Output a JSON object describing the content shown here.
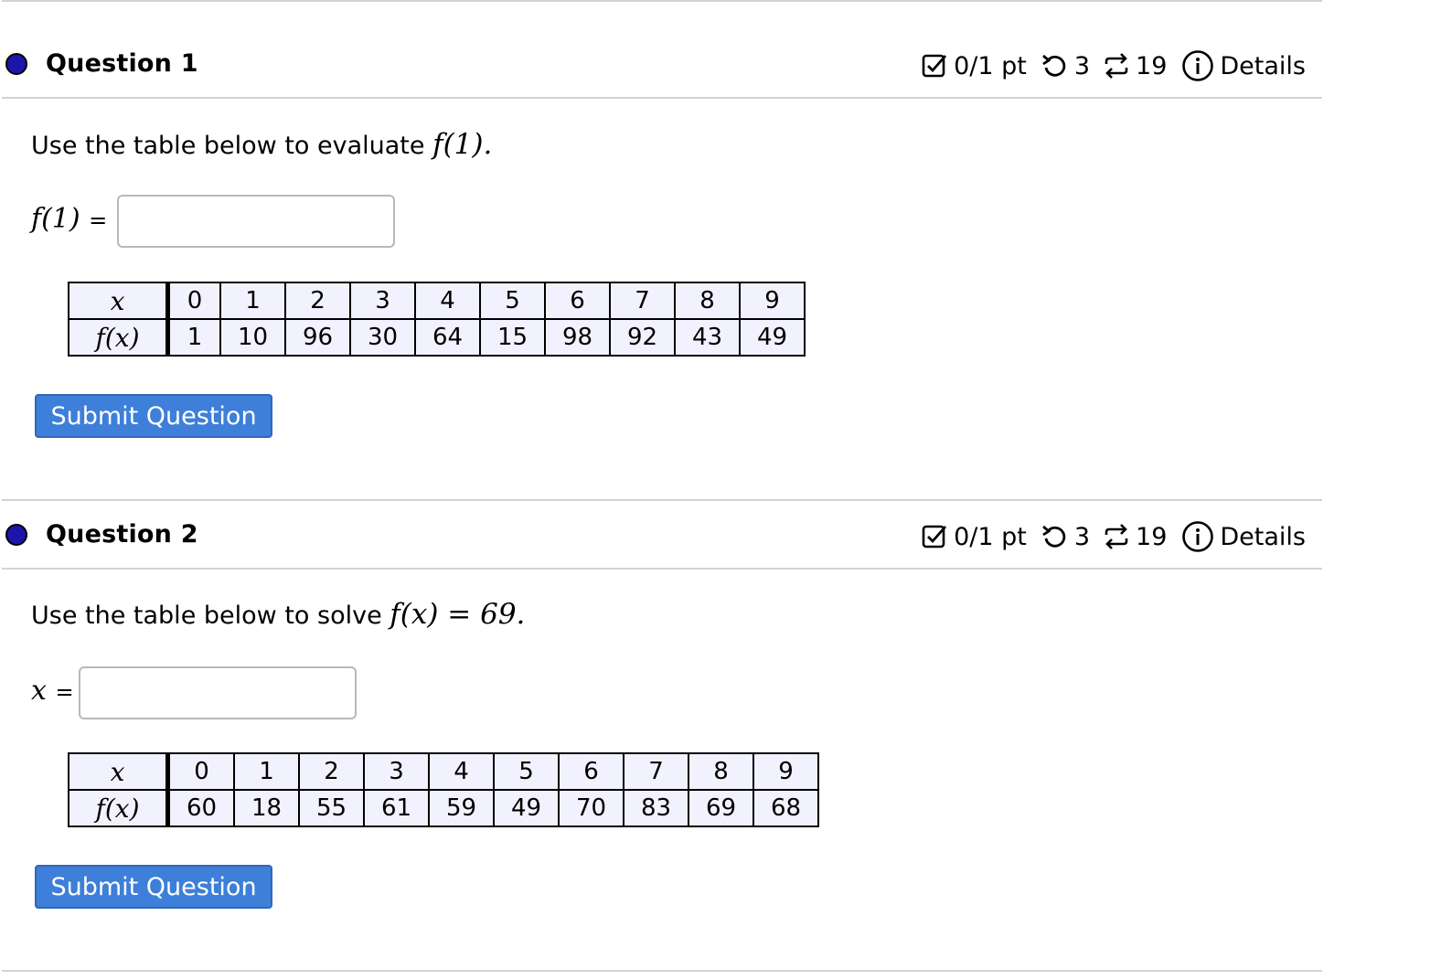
{
  "questions": [
    {
      "title": "Question 1",
      "score": "0/1 pt",
      "retries": "3",
      "attempts": "19",
      "details": "Details",
      "prompt_text": "Use the table below to evaluate",
      "prompt_math": "f(1).",
      "answer_label": "f(1)",
      "equals": "=",
      "answer_value": "",
      "table": {
        "row_labels": [
          "x",
          "f(x)"
        ],
        "x": [
          "0",
          "1",
          "2",
          "3",
          "4",
          "5",
          "6",
          "7",
          "8",
          "9"
        ],
        "fx": [
          "1",
          "10",
          "96",
          "30",
          "64",
          "15",
          "98",
          "92",
          "43",
          "49"
        ]
      },
      "submit_label": "Submit Question"
    },
    {
      "title": "Question 2",
      "score": "0/1 pt",
      "retries": "3",
      "attempts": "19",
      "details": "Details",
      "prompt_text": "Use the table below to solve",
      "prompt_math": "f(x) = 69.",
      "answer_label": "x",
      "equals": "=",
      "answer_value": "",
      "table": {
        "row_labels": [
          "x",
          "f(x)"
        ],
        "x": [
          "0",
          "1",
          "2",
          "3",
          "4",
          "5",
          "6",
          "7",
          "8",
          "9"
        ],
        "fx": [
          "60",
          "18",
          "55",
          "61",
          "59",
          "49",
          "70",
          "83",
          "69",
          "68"
        ]
      },
      "submit_label": "Submit Question"
    }
  ],
  "colors": {
    "dot": "#1a16a8",
    "button": "#3d7fd9",
    "table_bg": "#f2f2fe"
  },
  "icons": [
    "checkbox-score-icon",
    "retry-icon",
    "attempts-icon",
    "info-icon"
  ]
}
